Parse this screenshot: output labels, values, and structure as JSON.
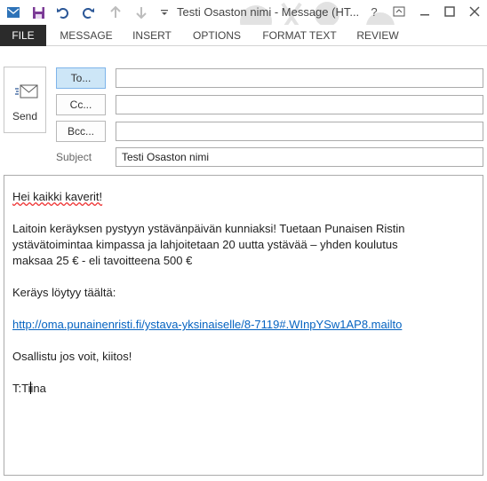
{
  "window": {
    "title": "Testi Osaston nimi - Message (HT...",
    "controls": [
      "?",
      "restore-ribbon",
      "minimize",
      "maximize",
      "close"
    ]
  },
  "quick_access": [
    "save-icon",
    "undo-icon",
    "redo-icon",
    "up-arrow-icon",
    "down-arrow-icon",
    "customize-icon"
  ],
  "ribbon": {
    "tabs": [
      "FILE",
      "MESSAGE",
      "INSERT",
      "OPTIONS",
      "FORMAT TEXT",
      "REVIEW"
    ]
  },
  "compose": {
    "send_label": "Send",
    "to_label": "To...",
    "cc_label": "Cc...",
    "bcc_label": "Bcc...",
    "to_value": "",
    "cc_value": "",
    "bcc_value": "",
    "subject_label": "Subject",
    "subject_value": "Testi Osaston nimi"
  },
  "body": {
    "greeting": "Hei kaikki kaverit!",
    "para1_line1": "Laitoin keräyksen pystyyn ystävänpäivän kunniaksi! Tuetaan Punaisen Ristin",
    "para1_line2": "ystävätoimintaa kimpassa ja lahjoitetaan 20 uutta ystävää – yhden koulutus",
    "para1_line3": "maksaa 25 € - eli tavoitteena 500 €",
    "para2": "Keräys löytyy täältä:",
    "link": "http://oma.punainenristi.fi/ystava-yksinaiselle/8-7119#.WInpYSw1AP8.mailto",
    "closing": "Osallistu jos voit, kiitos!",
    "sig_prefix": "T:Ti",
    "sig_suffix": "ina"
  }
}
